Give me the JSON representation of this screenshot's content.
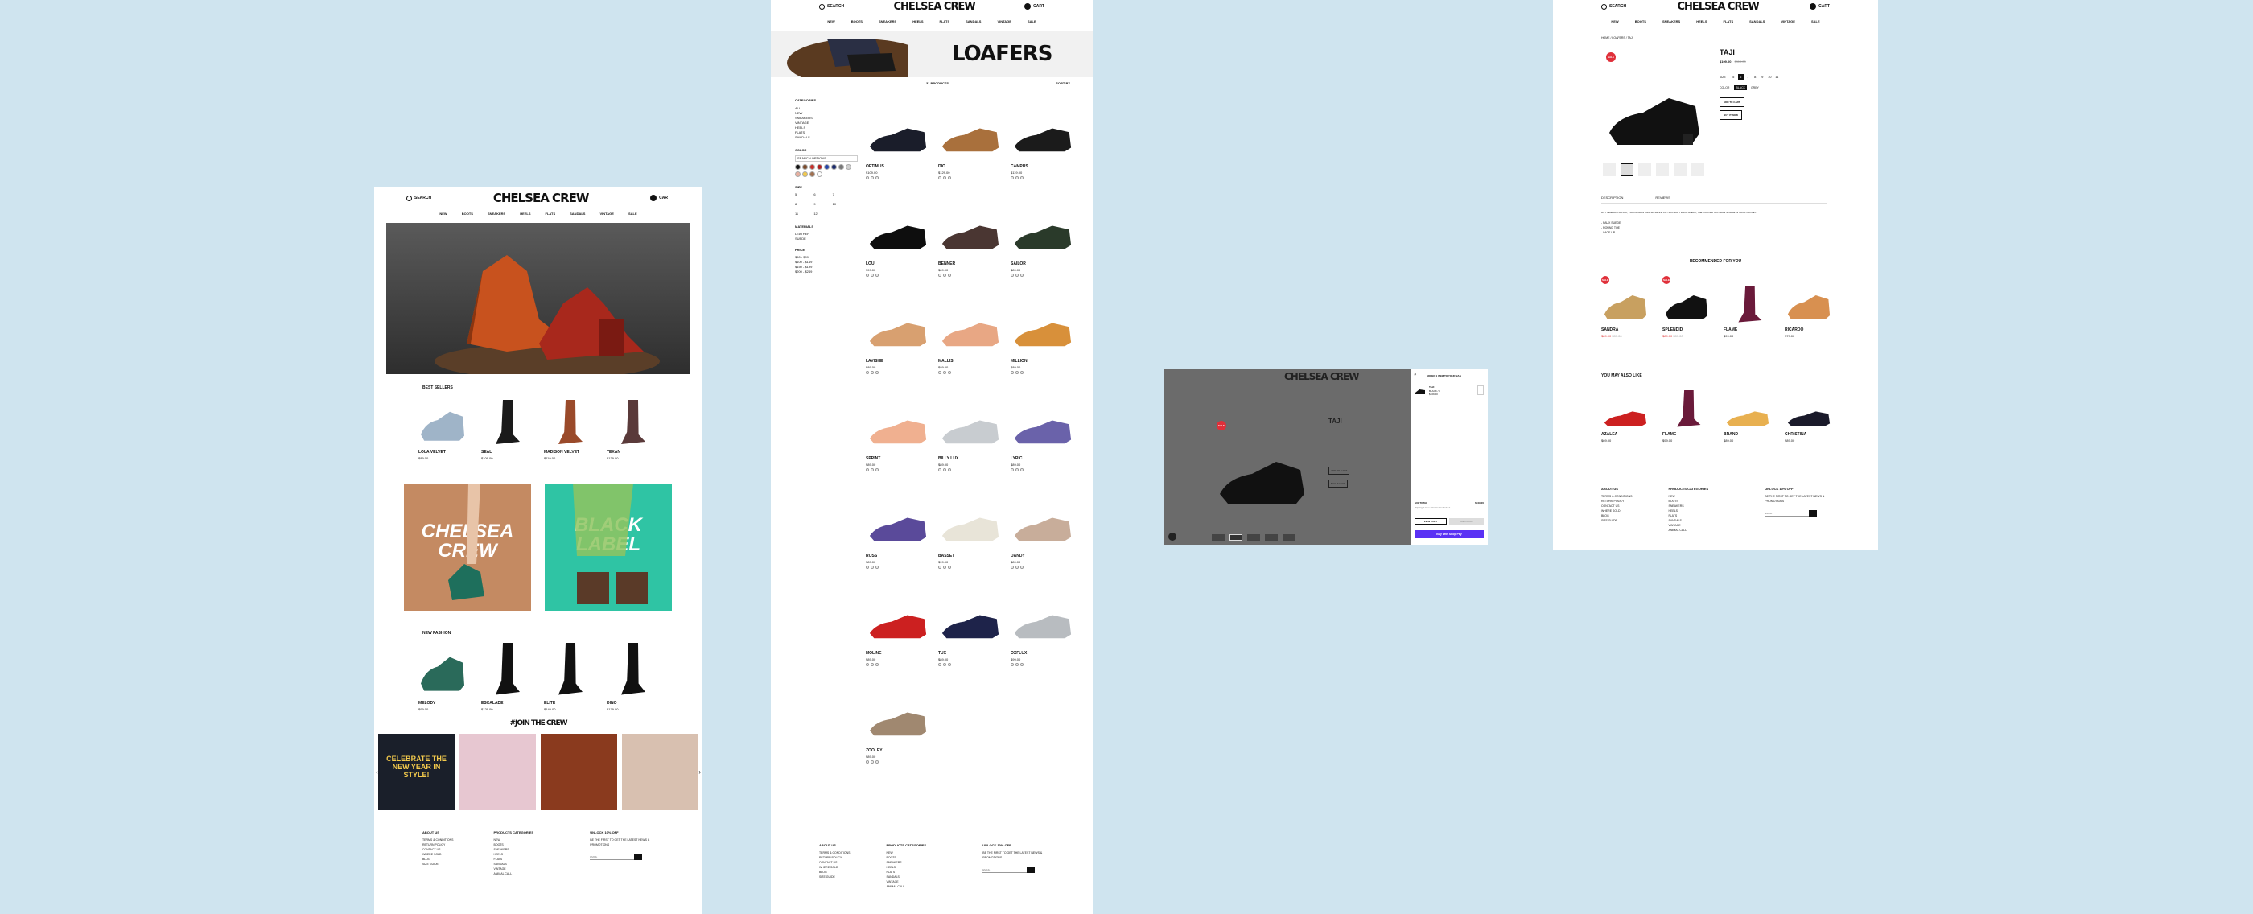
{
  "brand": "CHELSEA CREW",
  "header": {
    "search_label": "SEARCH",
    "cart_label": "CART",
    "cart_count": "0"
  },
  "nav": [
    "NEW",
    "BOOTS",
    "SNEAKERS",
    "HEELS",
    "FLATS",
    "SANDALS",
    "VINTAGE",
    "SALE"
  ],
  "home": {
    "best_sellers_title": "BEST SELLERS",
    "best_sellers": [
      {
        "name": "LOLA VELVET",
        "price": "$89.00"
      },
      {
        "name": "SEAL",
        "price": "$109.00"
      },
      {
        "name": "MADISON VELVET",
        "price": "$119.00"
      },
      {
        "name": "TEXAN",
        "price": "$139.00"
      }
    ],
    "promo_left": "CHELSEA CREW",
    "promo_right": "BLACK LABEL",
    "new_fashion_title": "NEW FASHION",
    "new_fashion": [
      {
        "name": "MELODY",
        "price": "$99.00"
      },
      {
        "name": "ESCALADE",
        "price": "$129.00"
      },
      {
        "name": "ELITE",
        "price": "$149.00"
      },
      {
        "name": "DINO",
        "price": "$179.00"
      }
    ],
    "join_title": "#JOIN THE CREW",
    "ig_banner_text": "CELEBRATE THE NEW YEAR IN STYLE!"
  },
  "footer": {
    "about_title": "ABOUT US",
    "about_items": [
      "TERMS & CONDITIONS",
      "RETURN POLICY",
      "CONTACT US",
      "WHERE SOLD",
      "BLOG",
      "SIZE GUIDE"
    ],
    "categories_title": "PRODUCTS CATEGORIES",
    "categories_items": [
      "NEW",
      "BOOTS",
      "SNEAKERS",
      "HEELS",
      "FLATS",
      "SANDALS",
      "VINTAGE",
      "ANIMAL CALL"
    ],
    "unlock_title": "UNLOCK 10% OFF",
    "unlock_text": "BE THE FIRST TO GET THE LATEST NEWS & PROMOTIONS",
    "email_placeholder": "EMAIL"
  },
  "category": {
    "hero_title": "LOAFERS",
    "products_count": "31 PRODUCTS",
    "sort_label": "SORT BY",
    "filters": {
      "categories_title": "CATEGORIES",
      "categories": [
        "ALL",
        "NEW",
        "SNEAKERS",
        "VINTAGE",
        "HEELS",
        "FLATS",
        "SANDALS"
      ],
      "color_title": "COLOR",
      "color_search": "SEARCH OPTIONS",
      "colors": [
        "#111111",
        "#7a4a2a",
        "#c6302b",
        "#b22222",
        "#2244aa",
        "#1b2a6b",
        "#777777",
        "#d0d0d0",
        "#e8b0a0",
        "#f2c94c",
        "#a07050",
        "#ffffff"
      ],
      "size_title": "SIZE",
      "sizes": [
        "5",
        "6",
        "7",
        "8",
        "9",
        "10",
        "11",
        "12"
      ],
      "materials_title": "MATERIALS",
      "materials": [
        "LEATHER",
        "SUEDE"
      ],
      "price_title": "PRICE",
      "prices": [
        "$50 - $99",
        "$100 - $149",
        "$150 - $199",
        "$200 - $249"
      ]
    },
    "products": [
      {
        "name": "OPTIMUS",
        "price": "$109.00",
        "color": "#1a1d2a"
      },
      {
        "name": "DIO",
        "price": "$129.00",
        "color": "#a9703c"
      },
      {
        "name": "CAMPUS",
        "price": "$119.00",
        "color": "#1b1b1b"
      },
      {
        "name": "LOU",
        "price": "$99.00",
        "color": "#0e0e0e"
      },
      {
        "name": "BENNER",
        "price": "$69.00",
        "color": "#4a3632"
      },
      {
        "name": "SAILOR",
        "price": "$89.00",
        "color": "#2a3a2a"
      },
      {
        "name": "LAVISHE",
        "price": "$89.00",
        "color": "#d8a070"
      },
      {
        "name": "MALLIS",
        "price": "$89.00",
        "color": "#e8a784"
      },
      {
        "name": "MILLION",
        "price": "$89.00",
        "color": "#d8903a"
      },
      {
        "name": "SPRINT",
        "price": "$89.00",
        "color": "#f0b090"
      },
      {
        "name": "BILLY LUX",
        "price": "$89.00",
        "color": "#c8ccd0"
      },
      {
        "name": "LYRIC",
        "price": "$89.00",
        "color": "#6a62aa"
      },
      {
        "name": "ROSS",
        "price": "$89.00",
        "color": "#5a4a9a"
      },
      {
        "name": "BASSET",
        "price": "$99.00",
        "color": "#e8e4d8"
      },
      {
        "name": "DANDY",
        "price": "$89.00",
        "color": "#c8ad9a"
      },
      {
        "name": "MOLINE",
        "price": "$89.00",
        "color": "#cc2020"
      },
      {
        "name": "TUX",
        "price": "$89.00",
        "color": "#1e234a"
      },
      {
        "name": "OXFLUX",
        "price": "$99.00",
        "color": "#b8bcc0"
      },
      {
        "name": "ZOOLEY",
        "price": "$89.00",
        "color": "#a08870"
      }
    ]
  },
  "product": {
    "breadcrumb": "HOME / LOAFERS / TAJI",
    "name": "TAJI",
    "price": "$109.00",
    "old_price": "$119.00",
    "size_label": "SIZE",
    "sizes": [
      "5",
      "6",
      "7",
      "8",
      "9",
      "10",
      "11"
    ],
    "color_label": "COLOR",
    "colors": [
      "BLACK",
      "GREY"
    ],
    "add_to_cart": "ADD TO CART",
    "buy_now": "BUY IT NOW",
    "tabs": [
      "DESCRIPTION",
      "REVIEWS"
    ],
    "description": "ANY TIME OF THE DAY, THIS DESIGN WILL IMPRESS. CUT IN A SOFT FAUX SUEDE, THE OXFORD IS A TRUE STAPLE IN YOUR CLOSET.",
    "details": [
      "- FAUX SUEDE",
      "- ROUND TOE",
      "- LACE UP"
    ],
    "badge": "SALE",
    "recommended_title": "RECOMMENDED FOR YOU",
    "recommended": [
      {
        "name": "SANDRA",
        "price": "$89.00",
        "old": "$99.00",
        "color": "#c8a060"
      },
      {
        "name": "SPLENDID",
        "price": "$89.00",
        "old": "$99.00",
        "color": "#111111"
      },
      {
        "name": "FLAME",
        "price": "$99.00",
        "old": "",
        "color": "#6a1a3a"
      },
      {
        "name": "RICARDO",
        "price": "$79.00",
        "old": "",
        "color": "#d89050"
      }
    ],
    "also_like_title": "YOU MAY ALSO LIKE",
    "also_like": [
      {
        "name": "AZALEA",
        "price": "$69.00",
        "color": "#cc2020"
      },
      {
        "name": "FLAME",
        "price": "$99.00",
        "color": "#6a1a3a"
      },
      {
        "name": "BRAND",
        "price": "$89.00",
        "color": "#e8b050"
      },
      {
        "name": "CHRISTINA",
        "price": "$89.00",
        "color": "#1a1a2a"
      }
    ]
  },
  "cart_drawer": {
    "title": "ADDED 1 ITEM TO YOUR BAG",
    "item_name": "TAJI",
    "item_meta": "BLACK / 8",
    "item_price": "$109.00",
    "subtotal_label": "SUBTOTAL",
    "subtotal_value": "$109.00",
    "note": "Shipping & taxes calculated at checkout",
    "view_cart": "VIEW CART",
    "checkout": "CHECKOUT",
    "shop_pay": "Buy with Shop Pay",
    "accent": "#5a31f4"
  }
}
